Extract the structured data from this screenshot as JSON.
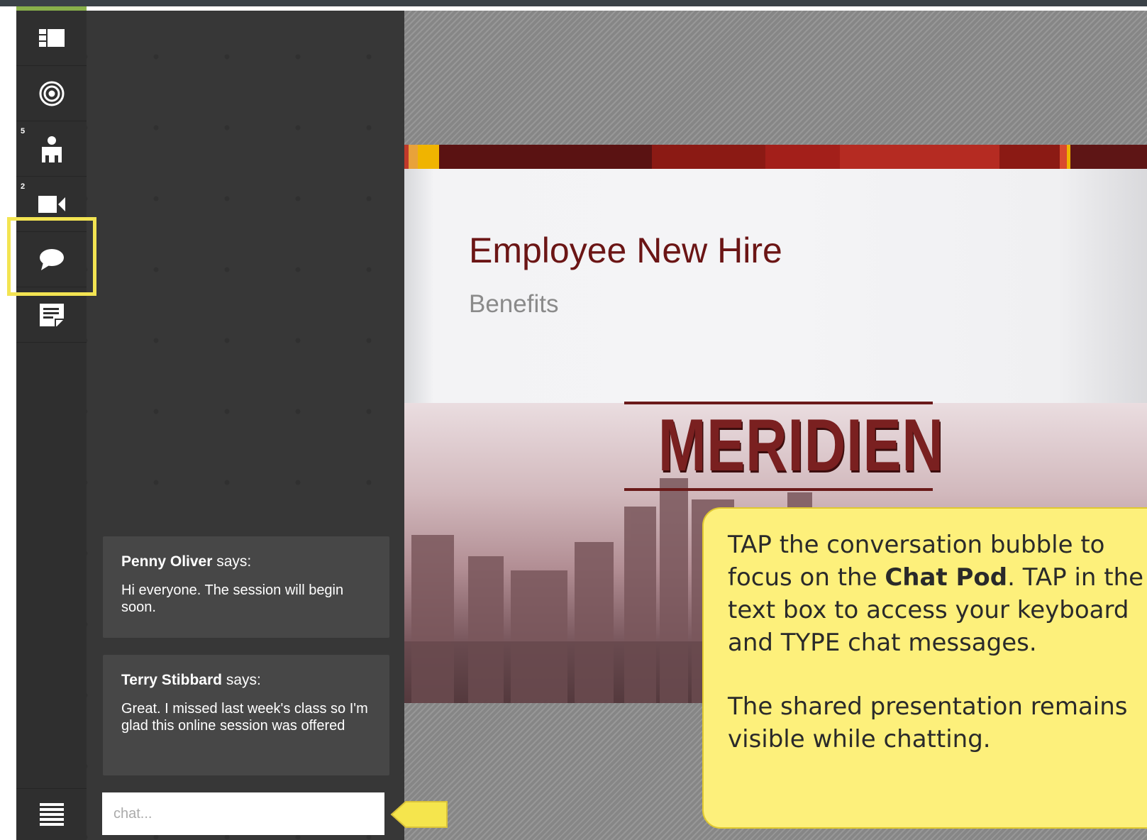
{
  "rail": {
    "items": [
      {
        "icon": "layout-icon"
      },
      {
        "icon": "target-icon"
      },
      {
        "icon": "attendees-icon",
        "badge": "5"
      },
      {
        "icon": "video-icon",
        "badge": "2"
      },
      {
        "icon": "chat-bubble-icon"
      },
      {
        "icon": "notes-icon"
      }
    ],
    "menu_icon": "hamburger-menu-icon"
  },
  "chat": {
    "messages": [
      {
        "author": "Penny Oliver",
        "says": " says:",
        "text": "Hi everyone. The session will begin soon."
      },
      {
        "author": "Terry Stibbard",
        "says": " says:",
        "text": "Great. I missed last week's class so I'm glad this online session was offered"
      }
    ],
    "input_placeholder": "chat..."
  },
  "slide": {
    "title": "Employee New Hire",
    "subtitle": "Benefits",
    "logo": "MERIDIEN"
  },
  "tooltip": {
    "line1_a": "TAP the conversation bubble to focus on the ",
    "line1_b": "Chat Pod",
    "line1_c": ". TAP in the text box to access your keyboard and TYPE chat messages.",
    "line2": "The shared presentation remains visible while chatting."
  },
  "colors": {
    "highlight": "#f3e452",
    "tooltip_bg": "#fdf07b",
    "accent_green": "#88b04b",
    "slide_title": "#6b1515"
  }
}
